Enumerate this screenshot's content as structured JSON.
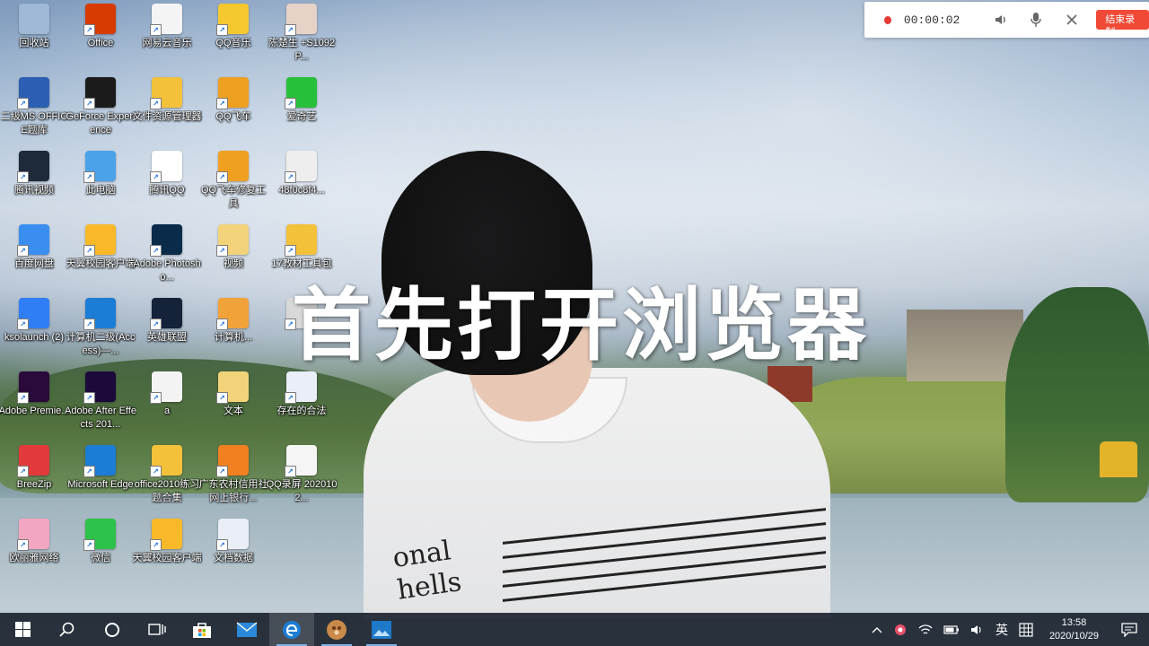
{
  "recorder": {
    "time": "00:00:02",
    "stop_label": "结束录制",
    "icons": [
      "speaker-icon",
      "microphone-icon",
      "close-icon"
    ]
  },
  "caption": "首先打开浏览器",
  "desktop_icons": [
    {
      "label": "回收站",
      "icon": "recycle-bin-icon",
      "color": "#9eb8d6"
    },
    {
      "label": "Office",
      "icon": "office-icon",
      "color": "#d83b01"
    },
    {
      "label": "网易云音乐",
      "icon": "file-icon",
      "color": "#f4f4f4"
    },
    {
      "label": "QQ音乐",
      "icon": "qq-music-icon",
      "color": "#f6c830"
    },
    {
      "label": "陈楚生 +S1092P...",
      "icon": "photo-icon",
      "color": "#e7d2c8"
    },
    {
      "label": "二级MS OFFICE题库",
      "icon": "exam-icon",
      "color": "#2c5fb3"
    },
    {
      "label": "GeForce Experience",
      "icon": "geforce-icon",
      "color": "#1b1b1b"
    },
    {
      "label": "文件资源管理器",
      "icon": "folder-icon",
      "color": "#f3c13a"
    },
    {
      "label": "QQ飞车",
      "icon": "qq-speed-icon",
      "color": "#f0a020"
    },
    {
      "label": "爱奇艺",
      "icon": "iqiyi-icon",
      "color": "#27c03a"
    },
    {
      "label": "腾讯视频",
      "icon": "tencent-video-icon",
      "color": "#1e2a3a"
    },
    {
      "label": "此电脑",
      "icon": "computer-icon",
      "color": "#4aa3e8"
    },
    {
      "label": "腾讯QQ",
      "icon": "qq-icon",
      "color": "#ffffff"
    },
    {
      "label": "QQ飞车修复工具",
      "icon": "repair-tool-icon",
      "color": "#f0a020"
    },
    {
      "label": "48f0c8f4...",
      "icon": "image-file-icon",
      "color": "#eeeeee"
    },
    {
      "label": "百度网盘",
      "icon": "baidu-netdisk-icon",
      "color": "#3a8ef0"
    },
    {
      "label": "天翼校园客户端",
      "icon": "campus-client-icon",
      "color": "#f9b928"
    },
    {
      "label": "Adobe Photosho...",
      "icon": "photoshop-icon",
      "color": "#0b2b4a"
    },
    {
      "label": "视频",
      "icon": "folder-zip-icon",
      "color": "#f3d37a"
    },
    {
      "label": "17教材工具包",
      "icon": "folder-icon",
      "color": "#f3c13a"
    },
    {
      "label": "ksolaunch (2)",
      "icon": "wps-icon",
      "color": "#2f7ef5"
    },
    {
      "label": "计算机二级(Access)—...",
      "icon": "ie-icon",
      "color": "#1c7dd6"
    },
    {
      "label": "英雄联盟",
      "icon": "lol-icon",
      "color": "#14233a"
    },
    {
      "label": "计算机...",
      "icon": "doc-icon",
      "color": "#f1a33a"
    },
    {
      "label": "",
      "icon": "blank-icon",
      "color": "#d8d8d8"
    },
    {
      "label": "Adobe Premie...",
      "icon": "premiere-icon",
      "color": "#2a0a3a"
    },
    {
      "label": "Adobe After Effects 201...",
      "icon": "after-effects-icon",
      "color": "#1c0a3a"
    },
    {
      "label": "a",
      "icon": "settings-file-icon",
      "color": "#f3f3f3"
    },
    {
      "label": "文本",
      "icon": "folder-zip-icon",
      "color": "#f3d37a"
    },
    {
      "label": "存在的合法",
      "icon": "word-doc-icon",
      "color": "#e9eef7"
    },
    {
      "label": "BreeZip",
      "icon": "breezip-icon",
      "color": "#e23a3a"
    },
    {
      "label": "Microsoft Edge",
      "icon": "edge-icon",
      "color": "#1c7dd6"
    },
    {
      "label": "office2010练习题合集",
      "icon": "folder-icon",
      "color": "#f3c13a"
    },
    {
      "label": "广东农村信用社网上银行...",
      "icon": "bank-icon",
      "color": "#f08020"
    },
    {
      "label": "QQ录屏 2020102...",
      "icon": "video-file-icon",
      "color": "#f5f5f5"
    },
    {
      "label": "欧丽雅网络",
      "icon": "gallery-icon",
      "color": "#f3a6c1"
    },
    {
      "label": "微信",
      "icon": "wechat-icon",
      "color": "#2ec24a"
    },
    {
      "label": "天翼校园客户端",
      "icon": "campus-client-icon",
      "color": "#f9b928"
    },
    {
      "label": "文档数据",
      "icon": "text-doc-icon",
      "color": "#e9eef7"
    }
  ],
  "taskbar": {
    "apps": [
      {
        "name": "start-button",
        "icon": "windows-icon"
      },
      {
        "name": "search-button",
        "icon": "search-icon"
      },
      {
        "name": "cortana-button",
        "icon": "cortana-icon"
      },
      {
        "name": "task-view-button",
        "icon": "task-view-icon"
      },
      {
        "name": "store-button",
        "icon": "store-icon"
      },
      {
        "name": "mail-button",
        "icon": "mail-icon"
      },
      {
        "name": "edge-button",
        "icon": "edge-icon"
      },
      {
        "name": "photos-app-button",
        "icon": "photos-icon"
      },
      {
        "name": "screenshot-app-button",
        "icon": "picture-icon"
      }
    ],
    "ime": "英",
    "time": "13:58",
    "date": "2020/10/29"
  }
}
